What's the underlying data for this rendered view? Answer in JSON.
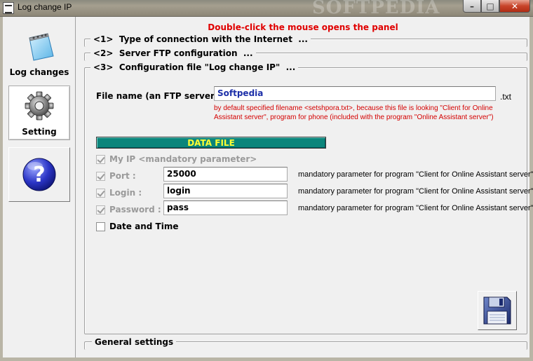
{
  "window": {
    "title": "Log change IP",
    "watermark": "SOFTPEDIA",
    "minimize_glyph": "–",
    "maximize_glyph": "□",
    "close_glyph": "✕"
  },
  "sidebar": {
    "items": [
      {
        "label": "Log changes",
        "icon": "notepad-icon"
      },
      {
        "label": "Setting",
        "icon": "gear-icon",
        "selected": true
      },
      {
        "label": "",
        "icon": "help-icon"
      }
    ]
  },
  "main": {
    "hint": "Double-click the mouse opens the panel",
    "sections": [
      {
        "label": "<1>  Type of connection with the Internet  ..."
      },
      {
        "label": "<2>  Server FTP configuration  ..."
      },
      {
        "label": "<3>  Configuration file \"Log change IP\"  ..."
      }
    ],
    "file_name_label": "File name (an FTP server)",
    "file_name_value": "Softpedia",
    "file_ext": ".txt",
    "file_note": "by default specified filename <setshpora.txt>, because this file is looking \"Client for Online Assistant server\", program for phone (included with the program \"Online Assistant server\")",
    "data_file_header": "DATA FILE",
    "fields": [
      {
        "label": "My IP <mandatory parameter>",
        "checked": true,
        "disabled": true,
        "value": null,
        "note": null
      },
      {
        "label": "Port :",
        "checked": true,
        "disabled": true,
        "value": "25000",
        "note": "mandatory parameter for program \"Client for Online Assistant server\""
      },
      {
        "label": "Login :",
        "checked": true,
        "disabled": true,
        "value": "login",
        "note": "mandatory parameter for program \"Client for Online Assistant server\""
      },
      {
        "label": "Password :",
        "checked": true,
        "disabled": true,
        "value": "pass",
        "note": "mandatory parameter for program \"Client for Online Assistant server\""
      },
      {
        "label": "Date and Time",
        "checked": false,
        "disabled": false,
        "value": null,
        "note": null
      }
    ],
    "general_settings": "General settings"
  },
  "colors": {
    "hint_red": "#e00000",
    "note_red": "#d40000",
    "data_file_bg": "#0b857b",
    "data_file_text": "#ffff33",
    "input_blue": "#1c2fa8"
  }
}
